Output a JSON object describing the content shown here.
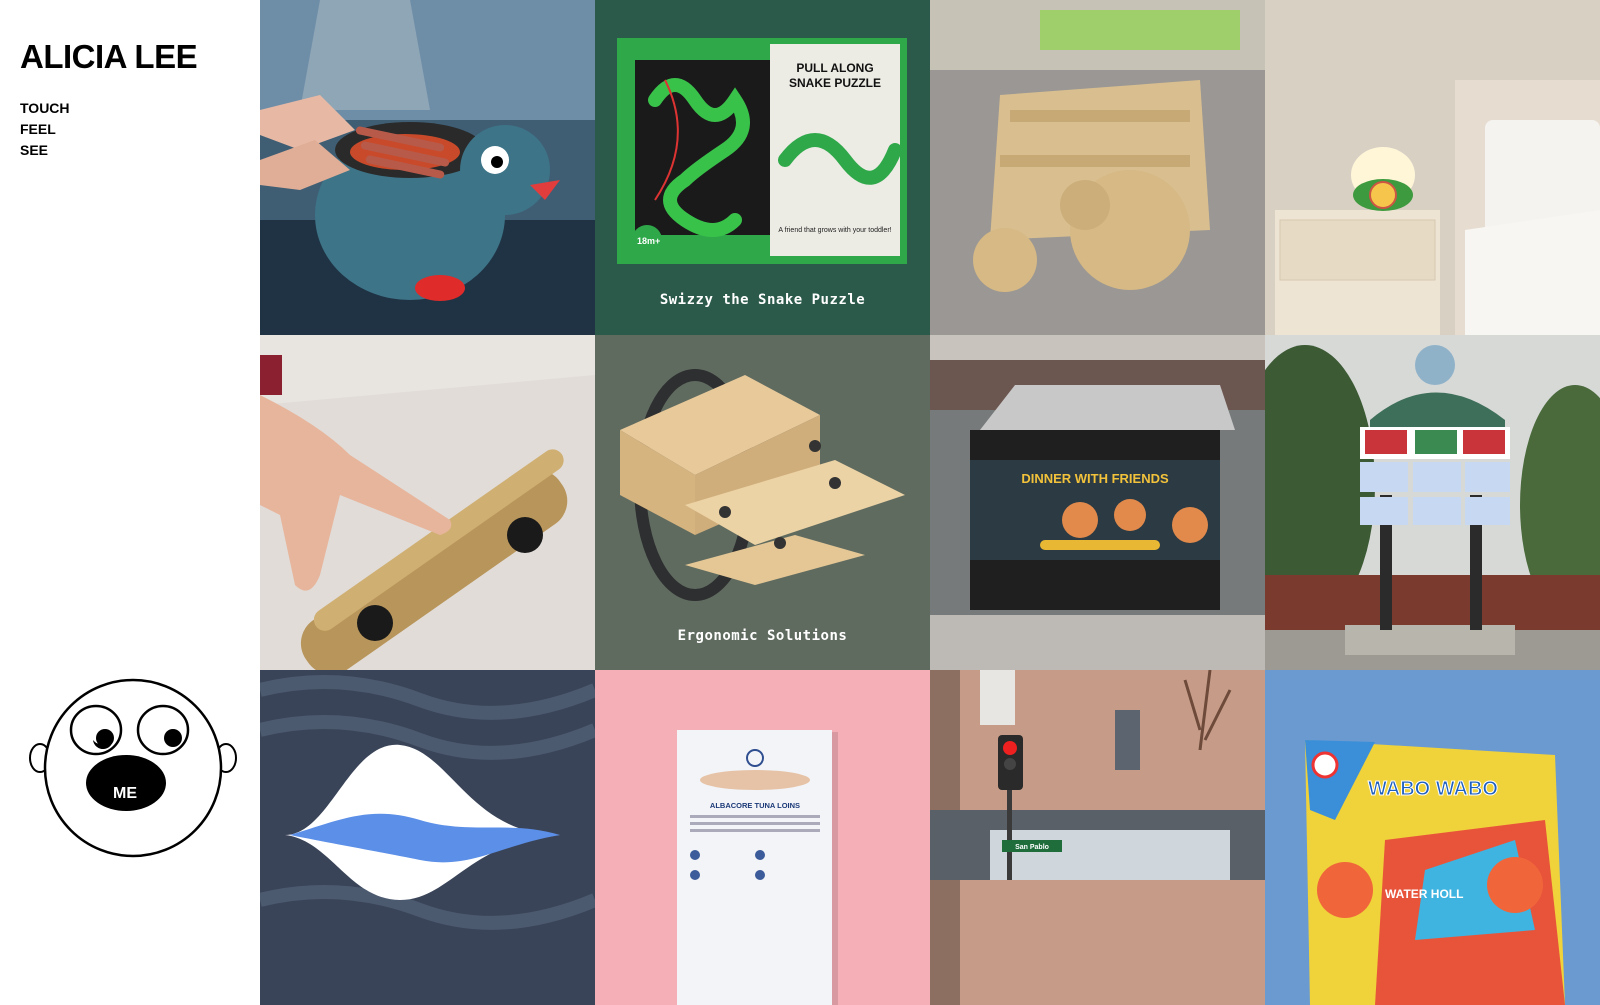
{
  "site": {
    "name": "ALICIA LEE",
    "nav": [
      "TOUCH",
      "FEEL",
      "SEE"
    ],
    "me_label": "ME"
  },
  "tiles": {
    "snake": {
      "box_title": "PULL ALONG SNAKE PUZZLE",
      "box_tagline": "A friend that grows with your toddler!",
      "age": "18m+",
      "caption": "Swizzy the Snake Puzzle"
    },
    "ergonomic": {
      "caption": "Ergonomic Solutions"
    },
    "kiosk": {
      "headline": "DINNER WITH FRIENDS"
    },
    "tuna": {
      "title": "ALBACORE TUNA LOINS"
    },
    "street": {
      "sign": "San Pablo"
    },
    "wabo": {
      "title": "WABO WABO",
      "subtitle": "WATER HOLL"
    }
  },
  "colors": {
    "snake_bg": "#2b5a4b",
    "ergo_bg": "#606b60",
    "pink_bg": "#f4b0b6",
    "sky_bg": "#6b9ad1"
  }
}
